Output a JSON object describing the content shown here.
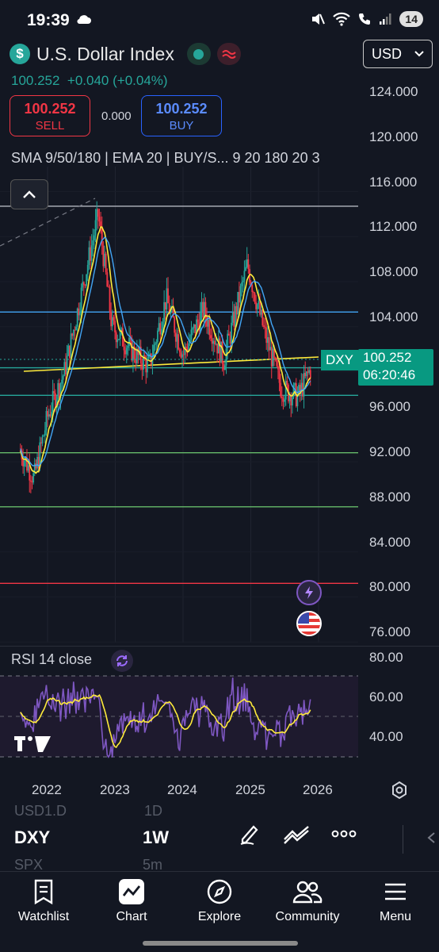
{
  "status": {
    "time": "19:39",
    "badge": "14"
  },
  "symbol": {
    "name": "U.S. Dollar Index",
    "price": "100.252",
    "change": "+0.040 (+0.04%)"
  },
  "trade": {
    "sell_price": "100.252",
    "sell_label": "SELL",
    "buy_price": "100.252",
    "buy_label": "BUY",
    "spread": "0.000"
  },
  "currency": {
    "selected": "USD"
  },
  "indicators": {
    "text": "SMA 9/50/180 | EMA 20 | BUY/S...  9  20  180  20  3"
  },
  "price_axis": [
    "124.000",
    "120.000",
    "116.000",
    "112.000",
    "108.000",
    "104.000",
    "100.000",
    "96.000",
    "92.000",
    "88.000",
    "84.000",
    "80.000",
    "76.000"
  ],
  "price_tag": {
    "symbol": "DXY",
    "price": "100.252",
    "countdown": "06:20:46"
  },
  "rsi": {
    "label": "RSI 14 close",
    "axis": [
      "80.00",
      "60.00",
      "40.00"
    ]
  },
  "time_axis": [
    "2022",
    "2023",
    "2024",
    "2025",
    "2026"
  ],
  "bottom": {
    "ghost_top_symbol": "USD1.D",
    "ghost_top_interval": "1D",
    "symbol": "DXY",
    "interval": "1W",
    "ghost_bottom_symbol": "SPX",
    "ghost_bottom_interval": "5m"
  },
  "tabs": [
    {
      "label": "Watchlist",
      "icon": "watchlist-icon"
    },
    {
      "label": "Chart",
      "icon": "chart-icon"
    },
    {
      "label": "Explore",
      "icon": "compass-icon"
    },
    {
      "label": "Community",
      "icon": "community-icon"
    },
    {
      "label": "Menu",
      "icon": "menu-icon"
    }
  ],
  "colors": {
    "up": "#26a69a",
    "down": "#f23645",
    "accent": "#2962ff",
    "background": "#131722"
  },
  "chart_data": {
    "type": "candlestick",
    "timeframe": "1W",
    "y_range": [
      76,
      126
    ],
    "x_ticks": [
      "2022",
      "2023",
      "2024",
      "2025",
      "2026"
    ],
    "approx_close_path": [
      {
        "t": 2021.6,
        "v": 93.0
      },
      {
        "t": 2021.8,
        "v": 90.5
      },
      {
        "t": 2022.0,
        "v": 96.0
      },
      {
        "t": 2022.25,
        "v": 100.0
      },
      {
        "t": 2022.5,
        "v": 107.0
      },
      {
        "t": 2022.75,
        "v": 114.0
      },
      {
        "t": 2022.95,
        "v": 104.0
      },
      {
        "t": 2023.3,
        "v": 101.5
      },
      {
        "t": 2023.5,
        "v": 100.5
      },
      {
        "t": 2023.75,
        "v": 106.5
      },
      {
        "t": 2024.0,
        "v": 101.5
      },
      {
        "t": 2024.3,
        "v": 105.5
      },
      {
        "t": 2024.6,
        "v": 101.0
      },
      {
        "t": 2024.95,
        "v": 109.5
      },
      {
        "t": 2025.2,
        "v": 103.5
      },
      {
        "t": 2025.45,
        "v": 98.5
      },
      {
        "t": 2025.7,
        "v": 97.8
      },
      {
        "t": 2025.88,
        "v": 100.25
      }
    ],
    "horizontal_levels": [
      {
        "value": 114.7,
        "color": "#b2b5be"
      },
      {
        "value": 105.3,
        "color": "#42a5f5"
      },
      {
        "value": 100.35,
        "color": "#26a69a"
      },
      {
        "value": 97.9,
        "color": "#26a69a"
      },
      {
        "value": 92.8,
        "color": "#66bb6a"
      },
      {
        "value": 88.0,
        "color": "#66bb6a"
      },
      {
        "value": 81.2,
        "color": "#f23645"
      }
    ],
    "rsi_levels": [
      70,
      50,
      30
    ]
  }
}
